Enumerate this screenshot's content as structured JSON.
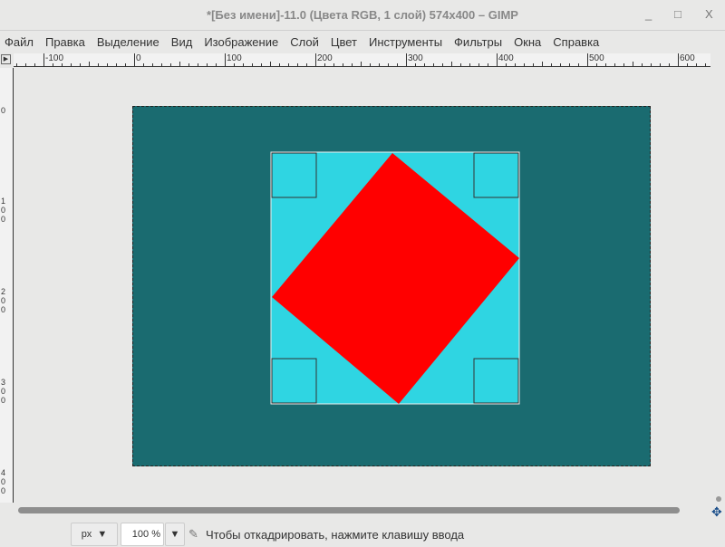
{
  "window": {
    "title": "*[Без имени]-11.0 (Цвета RGB, 1 слой) 574x400 – GIMP",
    "minimize": "_",
    "maximize": "□",
    "close": "X"
  },
  "menu": [
    "Файл",
    "Правка",
    "Выделение",
    "Вид",
    "Изображение",
    "Слой",
    "Цвет",
    "Инструменты",
    "Фильтры",
    "Окна",
    "Справка"
  ],
  "hruler": [
    "-100",
    "0",
    "100",
    "200",
    "300",
    "400",
    "500",
    "600"
  ],
  "vruler": [
    "0",
    "100",
    "200",
    "300",
    "400"
  ],
  "status": {
    "unit": "px",
    "zoom": "100 %",
    "message": "Чтобы откадрировать, нажмите клавишу ввода"
  },
  "colors": {
    "background": "#1a6b70",
    "square": "#2fd5e2",
    "diamond": "#ff0000"
  }
}
